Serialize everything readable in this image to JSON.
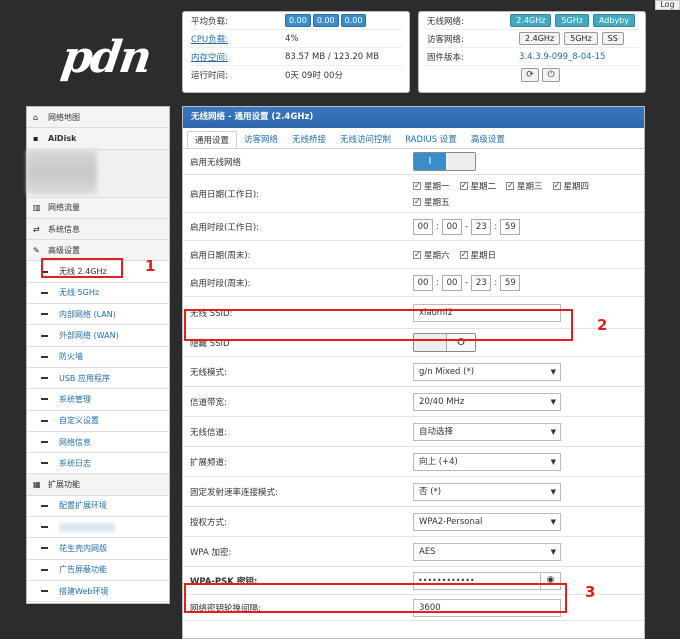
{
  "top_button": "Log",
  "logo": "pdn",
  "status": {
    "load_label": "平均负载:",
    "load": [
      "0.00",
      "0.00",
      "0.00"
    ],
    "cpu_label": "CPU负载:",
    "cpu": "4%",
    "mem_label": "内存空间:",
    "mem": "83.57 MB / 123.20 MB",
    "uptime_label": "运行时间:",
    "uptime": "0天 09时 00分"
  },
  "wireless": {
    "net_label": "无线网络:",
    "net_btns": [
      "2.4GHz",
      "5GHz",
      "Adbyby"
    ],
    "guest_label": "访客网络:",
    "guest_btns": [
      "2.4GHz",
      "5GHz",
      "SS"
    ],
    "fw_label": "固件版本:",
    "fw": "3.4.3.9-099_8-04-15",
    "icons": [
      "refresh-icon",
      "power-icon"
    ]
  },
  "sidebar": {
    "items": [
      {
        "label": "网络地图",
        "icon": "home-icon"
      },
      {
        "label": "AiDisk",
        "icon": "disk-icon"
      },
      {
        "label": "网络流量",
        "icon": "chart-icon"
      },
      {
        "label": "系统信息",
        "icon": "shuffle-icon"
      },
      {
        "label": "高级设置",
        "icon": "wrench-icon"
      }
    ],
    "sub1": [
      "无线 2.4GHz",
      "无线 5GHz",
      "内部网络 (LAN)",
      "外部网络 (WAN)",
      "防火墙",
      "USB 应用程序",
      "系统管理",
      "自定义设置",
      "网络信息",
      "系统日志"
    ],
    "ext": {
      "label": "扩展功能",
      "icon": "grid-icon"
    },
    "sub2": [
      "配置扩展环境",
      "",
      "花生壳内网版",
      "广告屏蔽功能",
      "搭建Web环境"
    ]
  },
  "annotations": [
    "1",
    "2",
    "3"
  ],
  "main": {
    "title": "无线网络 - 通用设置 (2.4GHz)",
    "tabs": [
      "通用设置",
      "访客网络",
      "无线桥接",
      "无线访问控制",
      "RADIUS 设置",
      "高级设置"
    ],
    "enable_label": "启用无线网络",
    "enable_on": "I",
    "workdays_label": "启用日期(工作日):",
    "workdays": [
      "星期一",
      "星期二",
      "星期三",
      "星期四",
      "星期五"
    ],
    "worktime_label": "启用时段(工作日):",
    "worktime": [
      "00",
      "00",
      "23",
      "59"
    ],
    "weekend_label": "启用日期(周末):",
    "weekend": [
      "星期六",
      "星期日"
    ],
    "weektime_label": "启用时段(周末):",
    "weektime": [
      "00",
      "00",
      "23",
      "59"
    ],
    "ssid_label": "无线 SSID:",
    "ssid": "xiaomi2",
    "hide_label": "隐藏 SSID",
    "hide_off": "O",
    "mode_label": "无线模式:",
    "mode": "g/n Mixed (*)",
    "bw_label": "信道带宽:",
    "bw": "20/40 MHz",
    "ch_label": "无线信道:",
    "ch": "自动选择",
    "ext_label": "扩展频道:",
    "ext": "向上 (+4)",
    "rate_label": "固定发射速率连接模式:",
    "rate": "否 (*)",
    "auth_label": "授权方式:",
    "auth": "WPA2-Personal",
    "enc_label": "WPA 加密:",
    "enc": "AES",
    "psk_label": "WPA-PSK 密钥:",
    "psk": "••••••••••••",
    "rekey_label": "网络密钥轮换间隔:",
    "rekey": "3600"
  }
}
